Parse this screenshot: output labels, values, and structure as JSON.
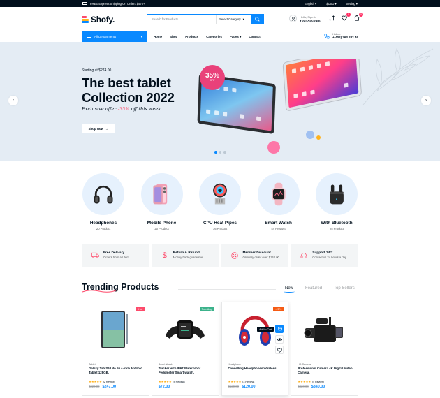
{
  "topbar": {
    "shipping": "FREE Express Shipping On Orders $570+",
    "language": "English",
    "currency": "$USD",
    "setting": "Setting"
  },
  "header": {
    "logo": "Shofy.",
    "search_placeholder": "Search for Products...",
    "category_select": "Select Category",
    "account_line1": "Hello, Sign In",
    "account_line2": "Your Account",
    "wishlist_count": "0",
    "cart_count": "0"
  },
  "nav": {
    "all_departments": "All Departments",
    "menu": [
      "Home",
      "Shop",
      "Products",
      "Categories",
      "Pages",
      "Contact"
    ],
    "hotline_label": "Hotline:",
    "hotline_number": "+(402) 763 282 46"
  },
  "hero": {
    "starting": "Starting at $274.00",
    "title": "The best tablet Collection 2022",
    "offer_pre": "Exclusive offer ",
    "offer_pct": "-35%",
    "offer_post": " off this week",
    "sticker_pct": "35%",
    "sticker_off": "OFF",
    "button": "Shop Now"
  },
  "categories": [
    {
      "name": "Headphones",
      "count": "20 Product",
      "icon": "headphones-icon"
    },
    {
      "name": "Mobile Phone",
      "count": "20 Product",
      "icon": "phone-icon"
    },
    {
      "name": "CPU Heat Pipes",
      "count": "16 Product",
      "icon": "cpu-cooler-icon"
    },
    {
      "name": "Smart Watch",
      "count": "44 Product",
      "icon": "watch-icon"
    },
    {
      "name": "With Bluetooth",
      "count": "25 Product",
      "icon": "earbuds-icon"
    }
  ],
  "features": [
    {
      "title": "Free Delivary",
      "sub": "Orders from all item",
      "icon": "truck-icon"
    },
    {
      "title": "Return & Refund",
      "sub": "Money back guarantee",
      "icon": "dollar-icon"
    },
    {
      "title": "Member Discount",
      "sub": "Onevery order over $140.00",
      "icon": "discount-icon"
    },
    {
      "title": "Support 24/7",
      "sub": "Contact us 24 hours a day",
      "icon": "headset-icon"
    }
  ],
  "trending": {
    "title": "Trending Products",
    "tabs": [
      "New",
      "Featured",
      "Top Sellers"
    ]
  },
  "products": [
    {
      "category": "Tablet",
      "title": "Galaxy Tab S6 Lite 10.4-inch Android Tablet 128GB.",
      "reviews": "(2 Review)",
      "old": "$320.00",
      "price": "$247.00",
      "tag": "Hot",
      "tag_color": "#fd4b6b"
    },
    {
      "category": "Smart Watch",
      "title": "Tracker with IP67 Waterproof Pedometer Smart watch.",
      "reviews": "(4 Review)",
      "old": "",
      "price": "$72.00",
      "tag": "Trending",
      "tag_color": "#3cb28b"
    },
    {
      "category": "Headphone",
      "title": "Cancelling Headphones Wireless.",
      "reviews": "(3 Review)",
      "old": "$120.00",
      "price": "$120.00",
      "tag": "-25%",
      "tag_color": "#f55b14",
      "tooltip": "Add to Cart"
    },
    {
      "category": "HD Camera",
      "title": "Professional Camera 4K Digital Video Camera.",
      "reviews": "(4 Review)",
      "old": "$420.00",
      "price": "$340.00",
      "tag": "",
      "tag_color": ""
    }
  ],
  "colors": {
    "accent": "#0989ff",
    "dark": "#010f1c",
    "pink": "#fd4b6b"
  }
}
